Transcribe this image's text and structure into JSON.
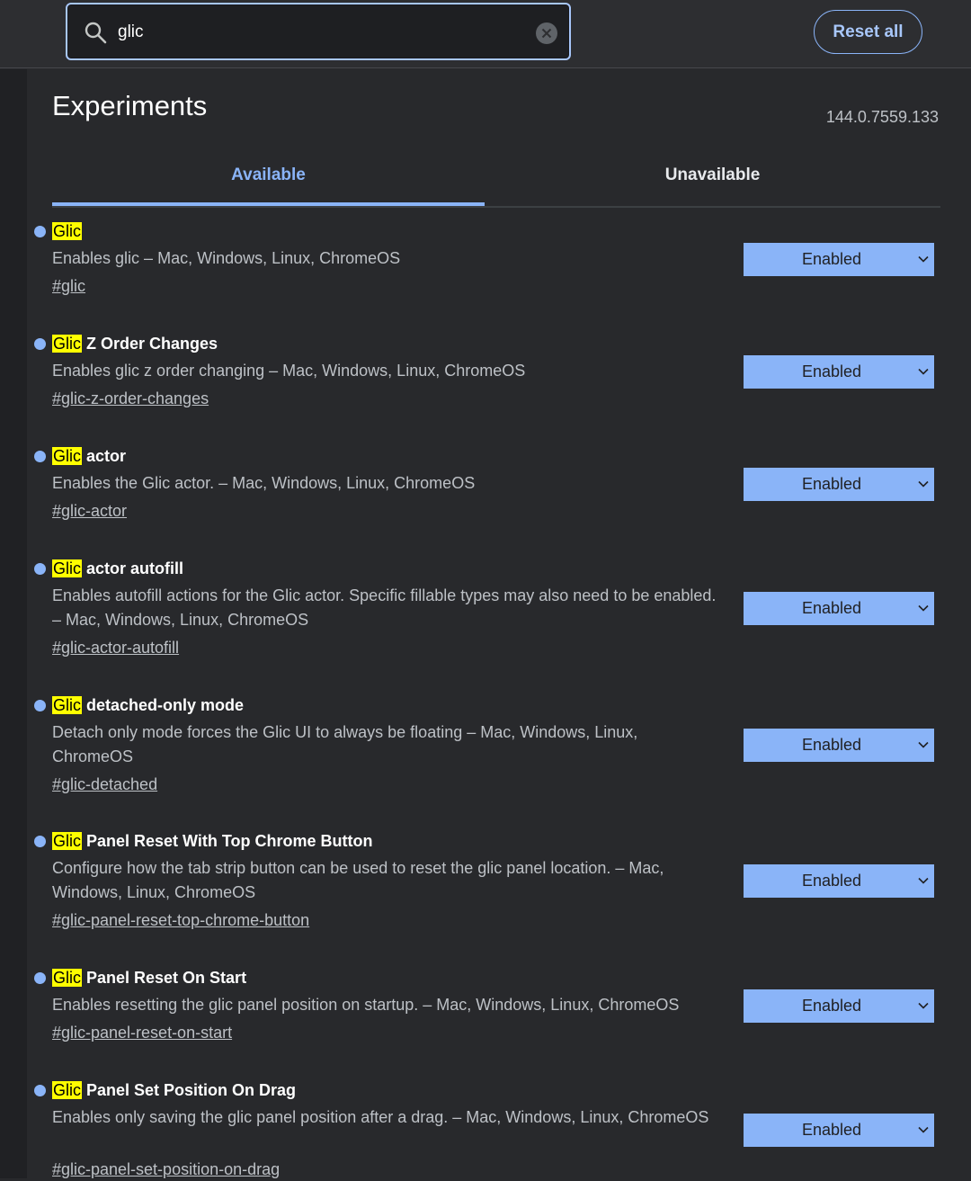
{
  "search": {
    "value": "glic"
  },
  "header": {
    "reset_label": "Reset all"
  },
  "page": {
    "title": "Experiments",
    "version": "144.0.7559.133"
  },
  "tabs": [
    {
      "label": "Available",
      "active": true
    },
    {
      "label": "Unavailable",
      "active": false
    }
  ],
  "experiments": [
    {
      "highlight": "Glic",
      "title_rest": "",
      "description": "Enables glic – Mac, Windows, Linux, ChromeOS",
      "link": "#glic",
      "state": "Enabled"
    },
    {
      "highlight": "Glic",
      "title_rest": " Z Order Changes",
      "description": "Enables glic z order changing – Mac, Windows, Linux, ChromeOS",
      "link": "#glic-z-order-changes",
      "state": "Enabled"
    },
    {
      "highlight": "Glic",
      "title_rest": " actor",
      "description": "Enables the Glic actor. – Mac, Windows, Linux, ChromeOS",
      "link": "#glic-actor",
      "state": "Enabled"
    },
    {
      "highlight": "Glic",
      "title_rest": " actor autofill",
      "description": "Enables autofill actions for the Glic actor. Specific fillable types may also need to be enabled. – Mac, Windows, Linux, ChromeOS",
      "link": "#glic-actor-autofill",
      "state": "Enabled"
    },
    {
      "highlight": "Glic",
      "title_rest": " detached-only mode",
      "description": "Detach only mode forces the Glic UI to always be floating – Mac, Windows, Linux, ChromeOS",
      "link": "#glic-detached",
      "state": "Enabled"
    },
    {
      "highlight": "Glic",
      "title_rest": " Panel Reset With Top Chrome Button",
      "description": "Configure how the tab strip button can be used to reset the glic panel location. – Mac, Windows, Linux, ChromeOS",
      "link": "#glic-panel-reset-top-chrome-button",
      "state": "Enabled"
    },
    {
      "highlight": "Glic",
      "title_rest": " Panel Reset On Start",
      "description": "Enables resetting the glic panel position on startup. – Mac, Windows, Linux, ChromeOS",
      "link": "#glic-panel-reset-on-start",
      "state": "Enabled"
    },
    {
      "highlight": "Glic",
      "title_rest": " Panel Set Position On Drag",
      "description": "Enables only saving the glic panel position after a drag. – Mac, Windows, Linux, ChromeOS",
      "link": "#glic-panel-set-position-on-drag",
      "state": "Enabled"
    }
  ],
  "colors": {
    "accent": "#8ab4f8",
    "highlight": "#ffff00",
    "background": "#28292c"
  }
}
